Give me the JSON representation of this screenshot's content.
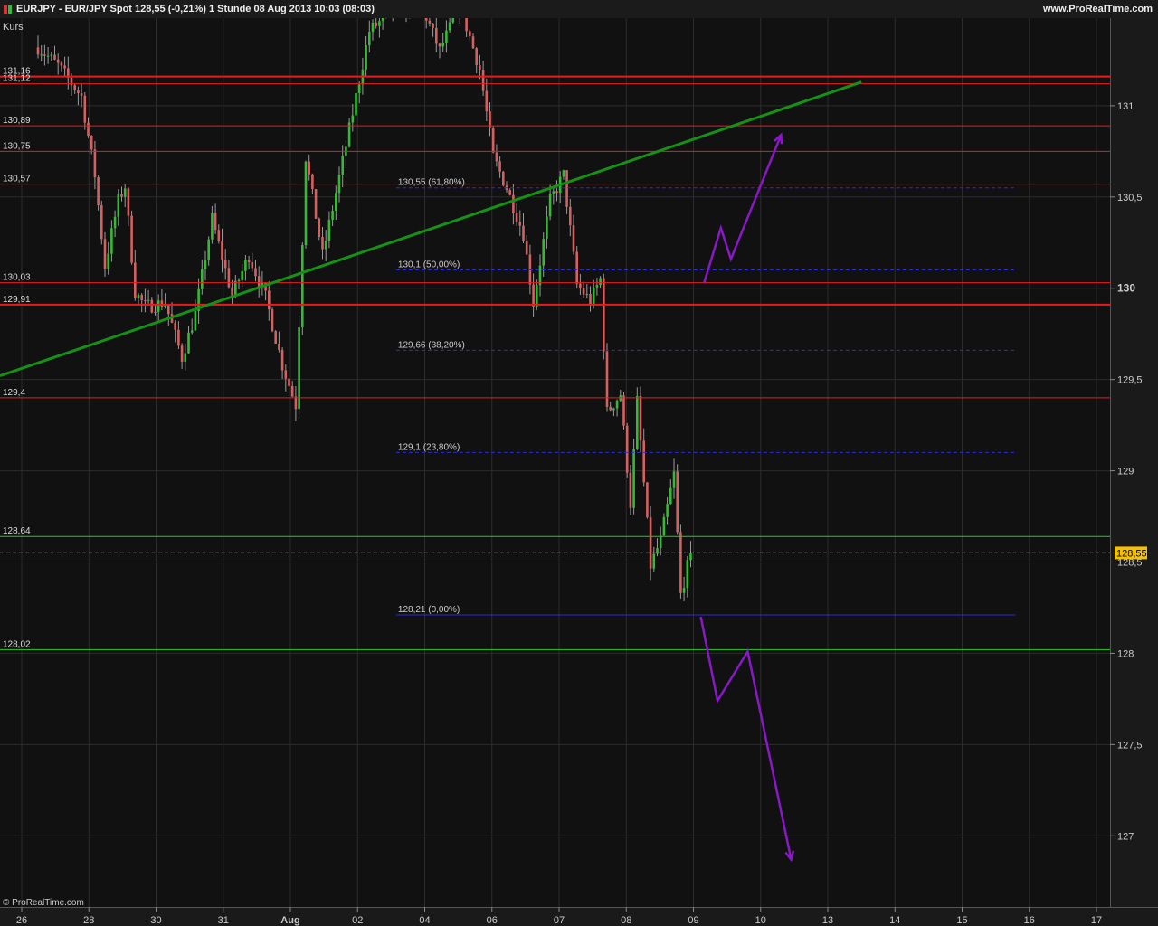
{
  "header": {
    "title": "EURJPY - EUR/JPY Spot    128,55 (-0,21%)    1 Stunde  08 Aug 2013 10:03 (08:03)",
    "brand": "www.ProRealTime.com"
  },
  "watermark": "© ProRealTime.com",
  "icons": {
    "header": "candlestick-icon"
  },
  "colors": {
    "background": "#111111",
    "grid": "#2c2c2c",
    "resistance": "#e81c1c",
    "support": "#22cc22",
    "trendline": "#169116",
    "fibonacci": "#2b2bd8",
    "projection": "#8a18c8",
    "candle_up": "#33bb33",
    "candle_down": "#d46060",
    "price_tag": "#f6c200"
  },
  "chart_data": {
    "type": "candlestick",
    "series_label": "Kurs",
    "x_axis_labels": [
      "26",
      "28",
      "30",
      "31",
      "Aug",
      "02",
      "04",
      "06",
      "07",
      "08",
      "09",
      "10",
      "13",
      "14",
      "15",
      "16",
      "17"
    ],
    "y_axis": {
      "min": 126.61,
      "max": 131.48,
      "ticks": [
        127,
        127.5,
        128,
        128.5,
        129,
        129.5,
        130,
        130.5,
        131
      ],
      "tick_labels": [
        "127",
        "127,5",
        "128",
        "128,5",
        "129",
        "129,5",
        "130",
        "130,5",
        "131"
      ]
    },
    "current_price": {
      "value": 128.55,
      "label": "128,55"
    },
    "horizontal_levels": [
      {
        "value": 131.16,
        "label": "131,16",
        "kind": "resistance",
        "weight": "thick"
      },
      {
        "value": 131.12,
        "label": "131,12",
        "kind": "resistance",
        "weight": "thin"
      },
      {
        "value": 130.89,
        "label": "130,89",
        "kind": "resistance",
        "weight": "thin"
      },
      {
        "value": 130.75,
        "label": "130,75",
        "kind": "resistance",
        "weight": "thin"
      },
      {
        "value": 130.57,
        "label": "130,57",
        "kind": "resistance",
        "weight": "thin"
      },
      {
        "value": 130.03,
        "label": "130,03",
        "kind": "resistance",
        "weight": "thin"
      },
      {
        "value": 129.91,
        "label": "129,91",
        "kind": "resistance",
        "weight": "thick"
      },
      {
        "value": 129.4,
        "label": "129,4",
        "kind": "resistance",
        "weight": "thin"
      },
      {
        "value": 128.64,
        "label": "128,64",
        "kind": "support",
        "weight": "thin"
      },
      {
        "value": 128.02,
        "label": "128,02",
        "kind": "support",
        "weight": "thin"
      }
    ],
    "fibonacci_levels": [
      {
        "value": 130.55,
        "label": "130,55 (61,80%)"
      },
      {
        "value": 130.1,
        "label": "130,1 (50,00%)"
      },
      {
        "value": 129.66,
        "label": "129,66 (38,20%)"
      },
      {
        "value": 129.1,
        "label": "129,1 (23,80%)"
      },
      {
        "value": 128.21,
        "label": "128,21 (0,00%)"
      }
    ],
    "trendline": {
      "start": {
        "bar": 0,
        "value": 129.52
      },
      "end": {
        "bar": 246,
        "value": 131.13
      }
    },
    "projections": [
      [
        {
          "bar": 199,
          "value": 130.03
        },
        {
          "bar": 204,
          "value": 130.33
        },
        {
          "bar": 207,
          "value": 130.16
        },
        {
          "bar": 222,
          "value": 130.84
        }
      ],
      [
        {
          "bar": 198,
          "value": 128.2
        },
        {
          "bar": 203,
          "value": 127.74
        },
        {
          "bar": 212,
          "value": 128.01
        },
        {
          "bar": 225,
          "value": 126.87
        }
      ]
    ],
    "close_path": [
      {
        "bar": 0,
        "value": 131.32
      },
      {
        "bar": 6,
        "value": 131.22
      },
      {
        "bar": 13,
        "value": 131.05
      },
      {
        "bar": 17,
        "value": 130.62
      },
      {
        "bar": 20,
        "value": 130.12
      },
      {
        "bar": 24,
        "value": 130.48
      },
      {
        "bar": 26,
        "value": 130.56
      },
      {
        "bar": 29,
        "value": 129.98
      },
      {
        "bar": 32,
        "value": 129.9
      },
      {
        "bar": 38,
        "value": 129.92
      },
      {
        "bar": 43,
        "value": 129.62
      },
      {
        "bar": 47,
        "value": 129.86
      },
      {
        "bar": 52,
        "value": 130.38
      },
      {
        "bar": 58,
        "value": 129.96
      },
      {
        "bar": 63,
        "value": 130.18
      },
      {
        "bar": 68,
        "value": 129.95
      },
      {
        "bar": 73,
        "value": 129.58
      },
      {
        "bar": 77,
        "value": 129.36
      },
      {
        "bar": 80,
        "value": 130.72
      },
      {
        "bar": 85,
        "value": 130.18
      },
      {
        "bar": 92,
        "value": 130.78
      },
      {
        "bar": 99,
        "value": 131.41
      },
      {
        "bar": 106,
        "value": 131.52
      },
      {
        "bar": 114,
        "value": 131.58
      },
      {
        "bar": 120,
        "value": 131.3
      },
      {
        "bar": 126,
        "value": 131.55
      },
      {
        "bar": 132,
        "value": 131.2
      },
      {
        "bar": 136,
        "value": 130.72
      },
      {
        "bar": 140,
        "value": 130.55
      },
      {
        "bar": 145,
        "value": 130.3
      },
      {
        "bar": 148,
        "value": 129.92
      },
      {
        "bar": 153,
        "value": 130.48
      },
      {
        "bar": 157,
        "value": 130.62
      },
      {
        "bar": 161,
        "value": 130.02
      },
      {
        "bar": 165,
        "value": 129.93
      },
      {
        "bar": 168,
        "value": 130.05
      },
      {
        "bar": 170,
        "value": 129.32
      },
      {
        "bar": 174,
        "value": 129.42
      },
      {
        "bar": 177,
        "value": 128.82
      },
      {
        "bar": 179,
        "value": 129.38
      },
      {
        "bar": 183,
        "value": 128.48
      },
      {
        "bar": 186,
        "value": 128.62
      },
      {
        "bar": 190,
        "value": 128.98
      },
      {
        "bar": 192,
        "value": 128.32
      },
      {
        "bar": 195,
        "value": 128.55
      }
    ]
  }
}
